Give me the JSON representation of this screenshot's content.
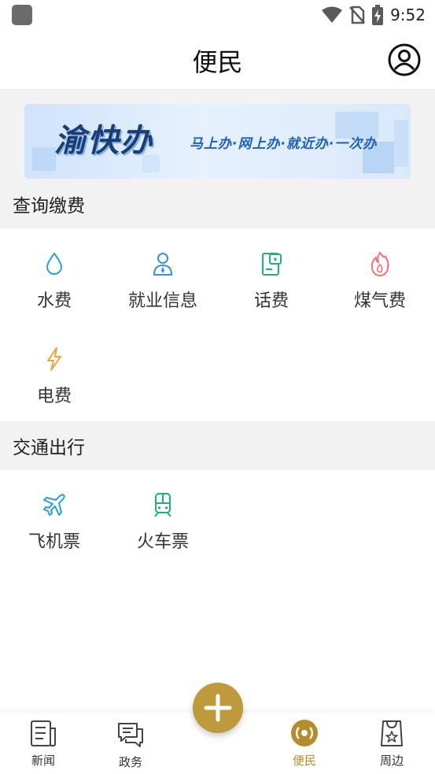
{
  "status_bar": {
    "time": "9:52"
  },
  "header": {
    "title": "便民"
  },
  "banner": {
    "logo_text": "渝快办",
    "slogan": "马上办·网上办·就近办·一次办"
  },
  "sections": [
    {
      "title": "查询缴费",
      "items": [
        {
          "label": "水费",
          "icon": "water-drop-icon",
          "color": "#2f9be8"
        },
        {
          "label": "就业信息",
          "icon": "person-tie-icon",
          "color": "#3a8fd6"
        },
        {
          "label": "话费",
          "icon": "phone-bill-icon",
          "color": "#21b07a"
        },
        {
          "label": "煤气费",
          "icon": "flame-icon",
          "color": "#f07272"
        },
        {
          "label": "电费",
          "icon": "lightning-icon",
          "color": "#f3a23a"
        }
      ]
    },
    {
      "title": "交通出行",
      "items": [
        {
          "label": "飞机票",
          "icon": "airplane-icon",
          "color": "#2f9be8"
        },
        {
          "label": "火车票",
          "icon": "train-icon",
          "color": "#21b07a"
        }
      ]
    }
  ],
  "bottom_nav": {
    "items": [
      {
        "label": "新闻",
        "icon": "news-icon"
      },
      {
        "label": "政务",
        "icon": "chat-icon"
      },
      {
        "label": "便民",
        "icon": "broadcast-icon",
        "active": true
      },
      {
        "label": "周边",
        "icon": "shopping-bag-icon"
      }
    ],
    "accent_color": "#b58b2e"
  }
}
